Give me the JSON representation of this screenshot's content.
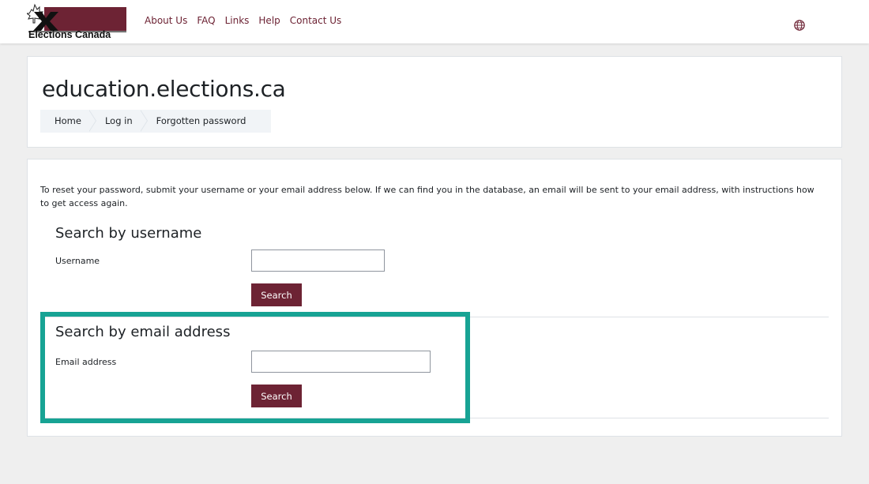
{
  "header": {
    "logo_text": "Elections Canada",
    "nav_links": [
      "About Us",
      "FAQ",
      "Links",
      "Help",
      "Contact Us"
    ],
    "language_icon": "globe-icon"
  },
  "page": {
    "site_title": "education.elections.ca",
    "breadcrumb": [
      "Home",
      "Log in",
      "Forgotten password"
    ]
  },
  "main": {
    "intro": "To reset your password, submit your username or your email address below. If we can find you in the database, an email will be sent to your email address, with instructions how to get access again.",
    "username_section": {
      "title": "Search by username",
      "label": "Username",
      "value": "",
      "button": "Search"
    },
    "email_section": {
      "title": "Search by email address",
      "label": "Email address",
      "value": "",
      "button": "Search"
    }
  },
  "colors": {
    "brand": "#6d2334",
    "highlight": "#17a394",
    "background": "#efefef"
  }
}
